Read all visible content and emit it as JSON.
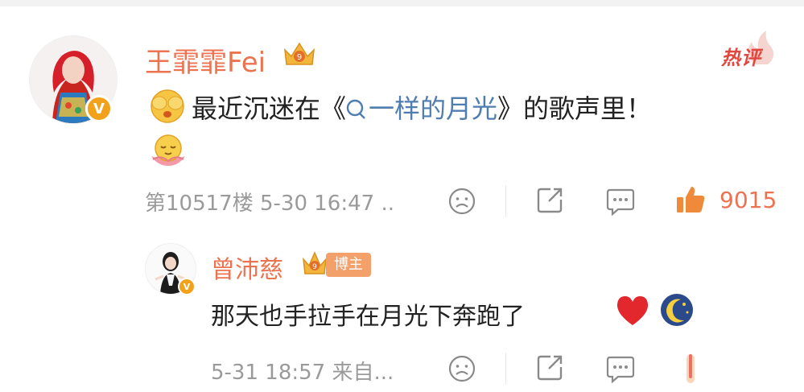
{
  "comment": {
    "author": "王霏霏Fei",
    "hot_label": "热评",
    "text_before": "最近沉迷在《",
    "link_text": "一样的月光",
    "text_after": "》的歌声里！",
    "meta": "第10517楼 5-30 16:47 ..",
    "likes": "9015"
  },
  "reply": {
    "author": "曾沛慈",
    "badge": "博主",
    "text": "那天也手拉手在月光下奔跑了",
    "meta": "5-31 18:57 来自..."
  },
  "icons": {
    "verified": "verified-v-icon",
    "crown": "crown-level-icon",
    "dislike": "frown-face-icon",
    "share": "share-icon",
    "comment": "comment-bubble-icon",
    "like": "thumbs-up-icon"
  },
  "colors": {
    "accent": "#eb7350",
    "link": "#507daf",
    "meta": "#9a9a9a",
    "hot": "#e0473e"
  }
}
